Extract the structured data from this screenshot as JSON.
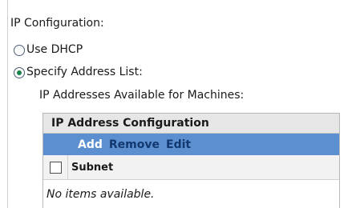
{
  "section": {
    "title": "IP Configuration:"
  },
  "options": {
    "use_dhcp_label": "Use DHCP",
    "specify_address_label": "Specify Address List:",
    "selected": "specify_address_list"
  },
  "address_list": {
    "label": "IP Addresses Available for Machines:",
    "panel_title": "IP Address Configuration",
    "toolbar": {
      "add_label": "Add",
      "remove_label": "Remove",
      "edit_label": "Edit"
    },
    "columns": [
      {
        "label": "Subnet"
      }
    ],
    "empty_text": "No items available."
  },
  "colors": {
    "toolbar_bg": "#5b8fcf",
    "toolbar_primary_text": "#ffffff",
    "toolbar_secondary_text": "#12386f",
    "header_bg": "#e6e6e6",
    "radio_selected": "#16824f"
  },
  "icons": {
    "radio_unchecked": "radio-unchecked-icon",
    "radio_checked": "radio-checked-icon",
    "select_all_checkbox": "checkbox-unchecked-icon"
  }
}
